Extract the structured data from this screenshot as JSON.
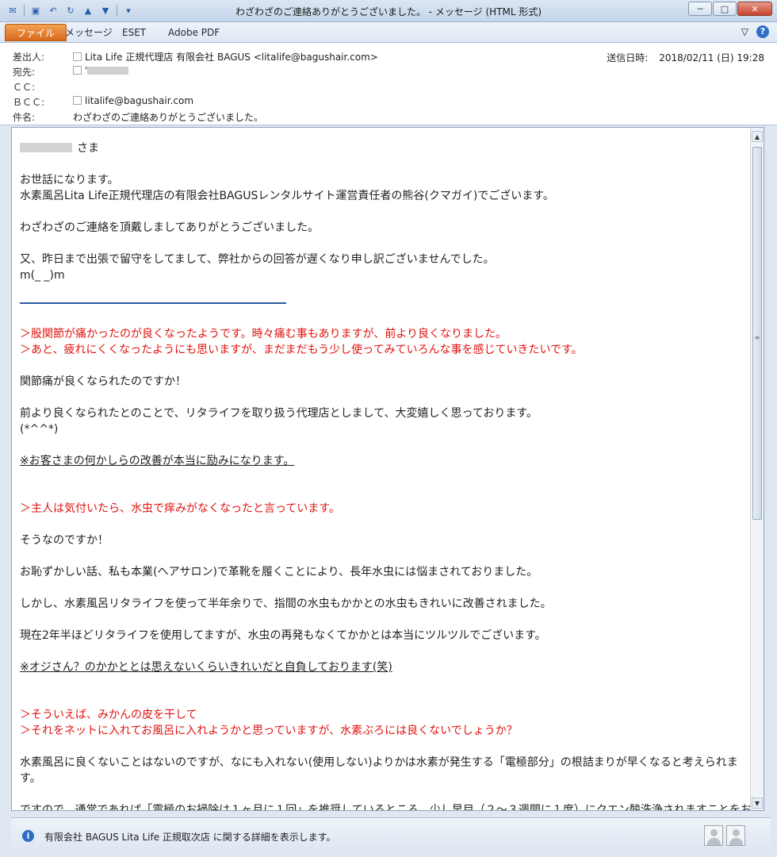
{
  "window": {
    "title": "わざわざのご連絡ありがとうございました。 - メッセージ (HTML 形式)",
    "minimize": "─",
    "maximize": "□",
    "close": "✕"
  },
  "qat": {
    "dropdown": "▾"
  },
  "ribbon": {
    "tabs": [
      "ファイル",
      "メッセージ",
      "ESET",
      "Adobe PDF"
    ],
    "collapse": "▽",
    "help": "?"
  },
  "header": {
    "from_label": "差出人:",
    "from_value": "Lita Life 正規代理店 有限会社 BAGUS <litalife@bagushair.com>",
    "to_label": "宛先:",
    "to_value": "'",
    "cc_label": "ＣＣ:",
    "bcc_label": "ＢＣＣ:",
    "bcc_value": "litalife@bagushair.com",
    "subject_label": "件名:",
    "subject_value": "わざわざのご連絡ありがとうございました。",
    "sent_label": "送信日時:",
    "sent_value": "2018/02/11 (日) 19:28"
  },
  "body": {
    "greeting_suffix": "さま",
    "p1": "お世話になります。",
    "p2": "水素風呂Lita Life正規代理店の有限会社BAGUSレンタルサイト運営責任者の熊谷(クマガイ)でございます。",
    "p3": "わざわざのご連絡を頂戴しましてありがとうございました。",
    "p4": "又、昨日まで出張で留守をしてまして、弊社からの回答が遅くなり申し訳ございませんでした。",
    "p5": "m(_ _)m",
    "q1a": "＞股関節が痛かったのが良くなったようです。時々痛む事もありますが、前より良くなりました。",
    "q1b": "＞あと、疲れにくくなったようにも思いますが、まだまだもう少し使ってみていろんな事を感じていきたいです。",
    "r1a": "関節痛が良くなられたのですか！",
    "r1b": "前より良くなられたとのことで、リタライフを取り扱う代理店としまして、大変嬉しく思っております。",
    "r1c": "(*^^*)",
    "r1d": "※お客さまの何かしらの改善が本当に励みになります。",
    "q2": "＞主人は気付いたら、水虫で痒みがなくなったと言っています。",
    "r2a": "そうなのですか！",
    "r2b": "お恥ずかしい話、私も本業(ヘアサロン)で革靴を履くことにより、長年水虫には悩まされておりました。",
    "r2c": "しかし、水素風呂リタライフを使って半年余りで、指間の水虫もかかとの水虫もきれいに改善されました。",
    "r2d": "現在2年半ほどリタライフを使用してますが、水虫の再発もなくてかかとは本当にツルツルでございます。",
    "r2e": "※オジさん？のかかととは思えないくらいきれいだと自負しております(笑)",
    "q3a": "＞そういえば、みかんの皮を干して",
    "q3b": "＞それをネットに入れてお風呂に入れようかと思っていますが、水素ぶろには良くないでしょうか？",
    "r3a": "水素風呂に良くないことはないのですが、なにも入れない(使用しない)よりかは水素が発生する「電極部分」の根詰まりが早くなると考えられます。",
    "r3b": "ですので、通常であれば「電極のお掃除は１ヶ月に１回」を推奨しているところ、少し早目（２～３週間に１度）にクエン酸洗浄されますことをお"
  },
  "status": {
    "text": "有限会社 BAGUS Lita Life 正規取次店 に関する詳細を表示します。"
  }
}
